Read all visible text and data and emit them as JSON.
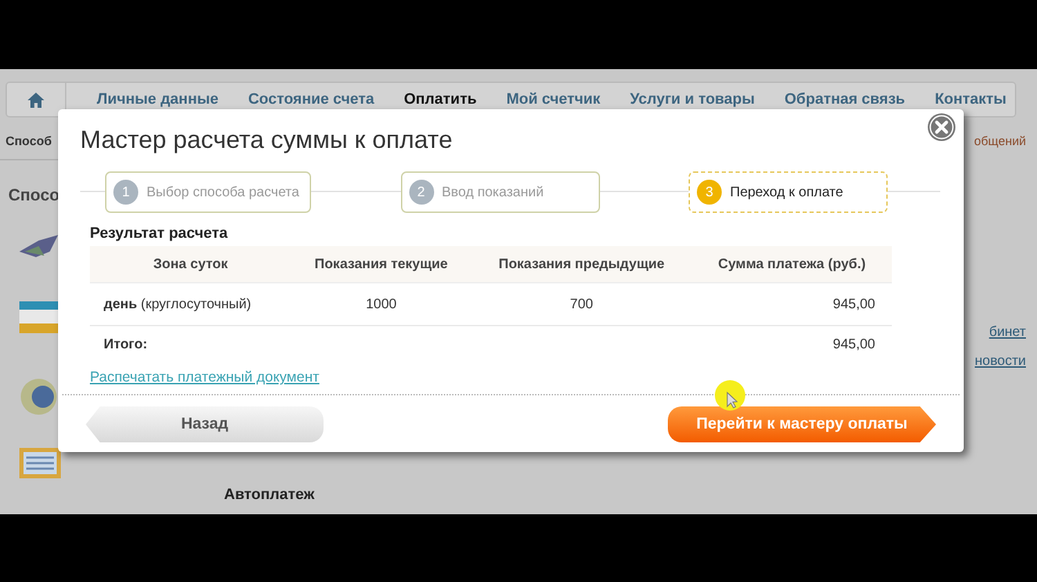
{
  "nav": {
    "items": [
      {
        "label": "Личные данные",
        "selected": false
      },
      {
        "label": "Состояние счета",
        "selected": false
      },
      {
        "label": "Оплатить",
        "selected": true
      },
      {
        "label": "Мой счетчик",
        "selected": false
      },
      {
        "label": "Услуги и товары",
        "selected": false
      },
      {
        "label": "Обратная связь",
        "selected": false
      },
      {
        "label": "Контакты",
        "selected": false
      }
    ]
  },
  "page": {
    "left_headings": [
      "Способ",
      "Спосо"
    ],
    "right_texts": [
      "общений",
      "бинет",
      "новости"
    ],
    "autopay": "Автоплатеж"
  },
  "dialog": {
    "title": "Мастер расчета суммы к оплате",
    "steps": [
      {
        "number": "1",
        "label": "Выбор способа расчета",
        "selected": false
      },
      {
        "number": "2",
        "label": "Ввод показаний",
        "selected": false
      },
      {
        "number": "3",
        "label": "Переход к оплате",
        "selected": true
      }
    ],
    "section_title": "Результат расчета",
    "table": {
      "columns": [
        "Зона суток",
        "Показания текущие",
        "Показания предыдущие",
        "Сумма платежа (руб.)"
      ],
      "rows": [
        {
          "kind": "item",
          "zone": "**день** (круглосуточный)",
          "current": "1000",
          "previous": "700",
          "sum": "945,00"
        },
        {
          "kind": "total",
          "zone": "Итого:",
          "sum": "945,00"
        }
      ]
    },
    "print_link": "Распечатать платежный документ",
    "buttons": [
      {
        "kind": "back",
        "label": "Назад"
      },
      {
        "kind": "primary",
        "label": "Перейти к мастеру оплаты"
      }
    ]
  }
}
